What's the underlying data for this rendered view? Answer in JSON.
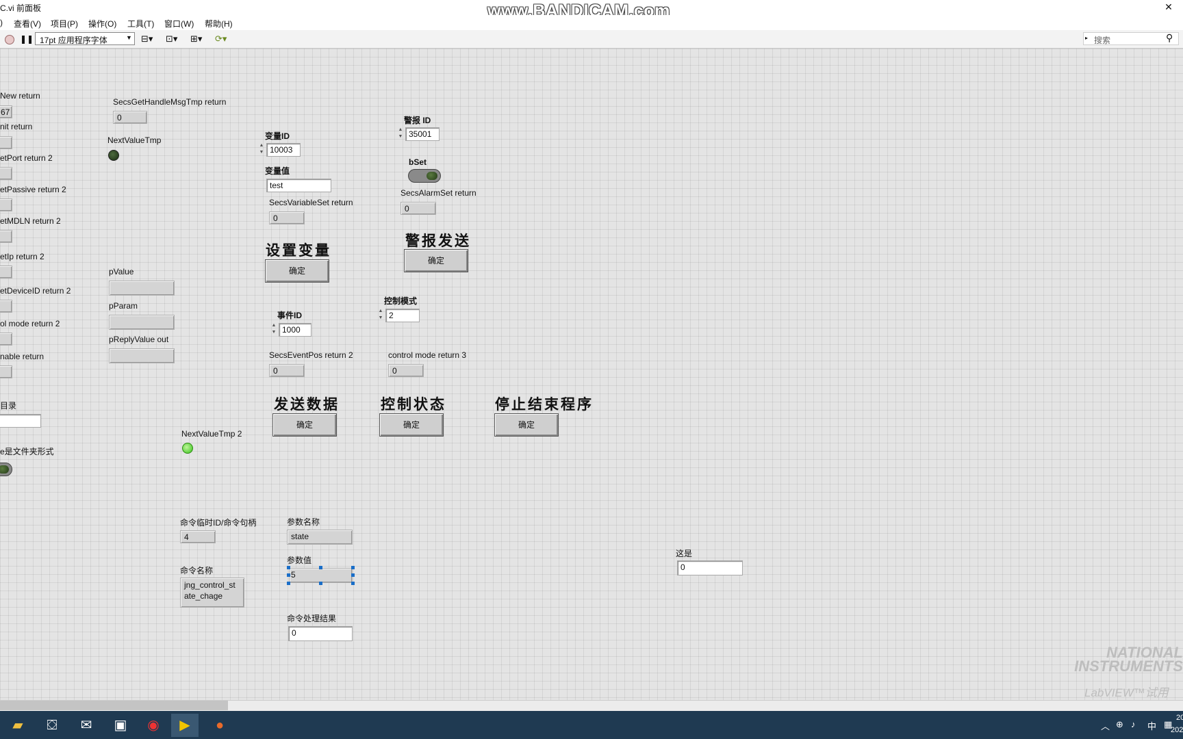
{
  "window": {
    "title": "C.vi 前面板",
    "watermark": "www.BANDICAM.com",
    "close": "✕"
  },
  "menu": [
    ")",
    "查看(V)",
    "项目(P)",
    "操作(O)",
    "工具(T)",
    "窗口(W)",
    "帮助(H)"
  ],
  "toolbar": {
    "font": "17pt 应用程序字体",
    "search_placeholder": "搜索"
  },
  "left_labels": {
    "new": "New return",
    "new_val": "67",
    "init": "nit return",
    "setport": "etPort return 2",
    "setpassive": "etPassive return 2",
    "setmdln": "etMDLN return 2",
    "setip": "etIp return 2",
    "setdeviceid": "etDeviceID return 2",
    "ctrlmode": "ol mode return 2",
    "enable": "nable return",
    "dir": "目录",
    "folder": "e是文件夹形式"
  },
  "handle": {
    "label": "SecsGetHandleMsgTmp return",
    "value": "0"
  },
  "next_value": {
    "label": "NextValueTmp",
    "label2": "NextValueTmp  2"
  },
  "pvalue": {
    "pvalue": "pValue",
    "pparam": "pParam",
    "preply": "pReplyValue out"
  },
  "var": {
    "id_label": "变量ID",
    "id_value": "10003",
    "val_label": "变量值",
    "val_value": "test",
    "ret_label": "SecsVariableSet  return",
    "ret_value": "0",
    "title": "设置变量",
    "button": "确定"
  },
  "alarm": {
    "id_label": "警报 ID",
    "id_value": "35001",
    "bset": "bSet",
    "ret_label": "SecsAlarmSet  return",
    "ret_value": "0",
    "title": "警报发送",
    "button": "确定"
  },
  "event": {
    "id_label": "事件ID",
    "id_value": "1000",
    "ret_label": "SecsEventPos return 2",
    "ret_value": "0",
    "title": "发送数据",
    "button": "确定"
  },
  "control": {
    "mode_label": "控制模式",
    "mode_value": "2",
    "ret_label": "control mode return 3",
    "ret_value": "0",
    "title": "控制状态",
    "button": "确定"
  },
  "stop": {
    "title": "停止结束程序",
    "button": "确定"
  },
  "command": {
    "id_label": "命令临时ID/命令句柄",
    "id_value": "4",
    "name_label": "命令名称",
    "name_value_1": "jng_control_st",
    "name_value_2": "ate_chage",
    "param_name_label": "参数名称",
    "param_name_value": "state",
    "param_value_label": "参数值",
    "param_value": "5",
    "result_label": "命令处理结果",
    "result_value": "0"
  },
  "misc": {
    "zheshi_label": "这是",
    "zheshi_value": "0"
  },
  "brand": {
    "ni": "NATIONAL INSTRUMENTS",
    "labview": "LabVIEW™试用"
  },
  "tray": {
    "ime": "中",
    "time": "20",
    "date": "202"
  }
}
